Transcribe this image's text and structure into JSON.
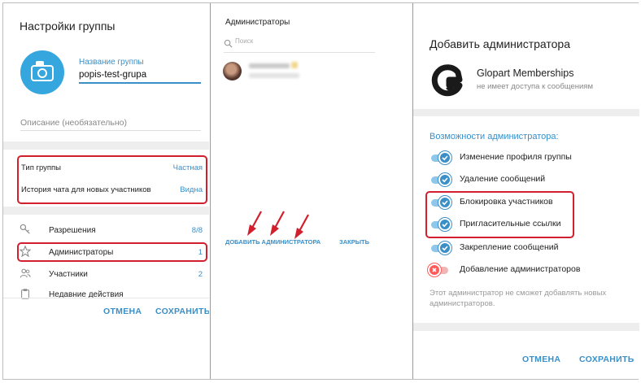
{
  "panel1": {
    "title": "Настройки группы",
    "group_name_label": "Название группы",
    "group_name_value": "popis-test-grupa",
    "description_placeholder": "Описание (необязательно)",
    "settings": [
      {
        "label": "Тип группы",
        "value": "Частная"
      },
      {
        "label": "История чата для новых участников",
        "value": "Видна"
      }
    ],
    "menu": [
      {
        "icon": "key-icon",
        "label": "Разрешения",
        "count": "8/8"
      },
      {
        "icon": "star-icon",
        "label": "Администраторы",
        "count": "1"
      },
      {
        "icon": "people-icon",
        "label": "Участники",
        "count": "2"
      },
      {
        "icon": "clipboard-icon",
        "label": "Недавние действия",
        "count": ""
      }
    ],
    "cancel_label": "ОТМЕНА",
    "save_label": "СОХРАНИТЬ"
  },
  "panel2": {
    "title": "Администраторы",
    "search_placeholder": "Поиск",
    "add_admin_label": "ДОБАВИТЬ АДМИНИСТРАТОРА",
    "close_label": "ЗАКРЫТЬ"
  },
  "panel3": {
    "title": "Добавить администратора",
    "bot_name": "Glopart Memberships",
    "bot_status": "не имеет доступа к сообщениям",
    "section_title": "Возможности администратора:",
    "permissions": [
      {
        "label": "Изменение профиля группы",
        "enabled": true
      },
      {
        "label": "Удаление сообщений",
        "enabled": true
      },
      {
        "label": "Блокировка участников",
        "enabled": true
      },
      {
        "label": "Пригласительные ссылки",
        "enabled": true
      },
      {
        "label": "Закрепление сообщений",
        "enabled": true
      },
      {
        "label": "Добавление администраторов",
        "enabled": false
      }
    ],
    "note": "Этот администратор не сможет добавлять новых администраторов.",
    "cancel_label": "ОТМЕНА",
    "save_label": "СОХРАНИТЬ"
  },
  "colors": {
    "accent": "#3a8fc8",
    "highlight": "#d21f2d",
    "avatar_bg": "#35a6de",
    "toggle_off": "#ff5a5a"
  }
}
